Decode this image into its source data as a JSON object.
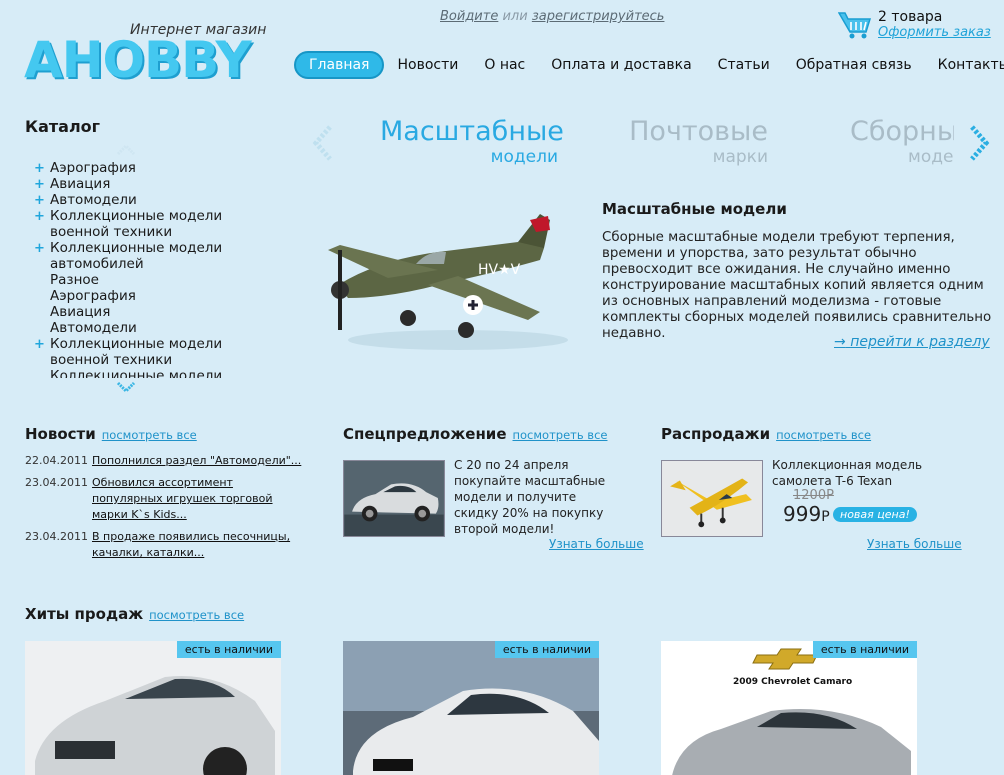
{
  "header": {
    "logo_subtitle": "Интернет магазин",
    "logo_text": "AHOBBY",
    "login_label": "Войдите",
    "or_label": "или",
    "register_label": "зарегистрируйтесь",
    "cart_count": "2 товара",
    "cart_order_label": "Оформить заказ",
    "icon": "basket-icon"
  },
  "nav": {
    "items": [
      {
        "label": "Главная",
        "active": true
      },
      {
        "label": "Новости"
      },
      {
        "label": "О нас"
      },
      {
        "label": "Оплата и доставка"
      },
      {
        "label": "Статьи"
      },
      {
        "label": "Обратная связь"
      },
      {
        "label": "Контакты"
      }
    ]
  },
  "catalog": {
    "title": "Каталог",
    "items": [
      {
        "label": "Аэрография",
        "plus": true
      },
      {
        "label": "Авиация",
        "plus": true
      },
      {
        "label": "Автомодели",
        "plus": true
      },
      {
        "label": "Коллекционные модели военной техники",
        "plus": true
      },
      {
        "label": "Коллекционные модели автомобилей",
        "plus": true
      },
      {
        "label": "Разное",
        "plus": false
      },
      {
        "label": "Аэрография",
        "plus": false
      },
      {
        "label": "Авиация",
        "plus": false
      },
      {
        "label": "Автомодели",
        "plus": false
      },
      {
        "label": "Коллекционные модели военной техники",
        "plus": true
      },
      {
        "label": "Коллекционные модели",
        "plus": false
      }
    ]
  },
  "carousel": {
    "tabs": [
      {
        "title": "Масштабные",
        "subtitle": "модели",
        "active": true
      },
      {
        "title": "Почтовые",
        "subtitle": "марки"
      },
      {
        "title": "Сборные",
        "subtitle": "модели"
      }
    ],
    "feature_title": "Масштабные модели",
    "feature_text": "Сборные масштабные модели требуют терпения, времени и упорства, зато результат обычно превосходит все ожидания. Не случайно именно конструирование масштабных копий является одним из основных направлений моделизма - готовые комплекты сборных моделей появились сравнительно недавно.",
    "feature_link": "перейти к разделу",
    "feature_link_arrow": "→"
  },
  "news": {
    "title": "Новости",
    "see_all": "посмотреть все",
    "items": [
      {
        "date": "22.04.2011",
        "text": "Пополнился раздел \"Автомодели\"..."
      },
      {
        "date": "23.04.2011",
        "text": "Обновился ассортимент популярных игрушек торговой марки K`s Kids..."
      },
      {
        "date": "23.04.2011",
        "text": "В продаже появились песочницы, качалки, каталки..."
      }
    ]
  },
  "special": {
    "title": "Спецпредложение",
    "see_all": "посмотреть все",
    "text": "С 20 по 24 апреля покупайте масштабные модели и получите скидку 20% на покупку второй модели!",
    "more": "Узнать больше"
  },
  "sale": {
    "title": "Распродажи",
    "see_all": "посмотреть все",
    "product_name": "Коллекционная модель самолета T-6 Texan",
    "old_price": "1200Р",
    "new_price": "999",
    "currency": "Р",
    "badge": "новая цена!",
    "more": "Узнать больше"
  },
  "hits": {
    "title": "Хиты продаж",
    "see_all": "посмотреть все",
    "items": [
      {
        "badge": "есть в наличии"
      },
      {
        "badge": "есть в наличии"
      },
      {
        "badge": "есть в наличии",
        "caption": "2009 Chevrolet Camaro"
      }
    ]
  },
  "colors": {
    "accent": "#2fb9e8",
    "background": "#d7ecf7",
    "link": "#1f92c9"
  }
}
